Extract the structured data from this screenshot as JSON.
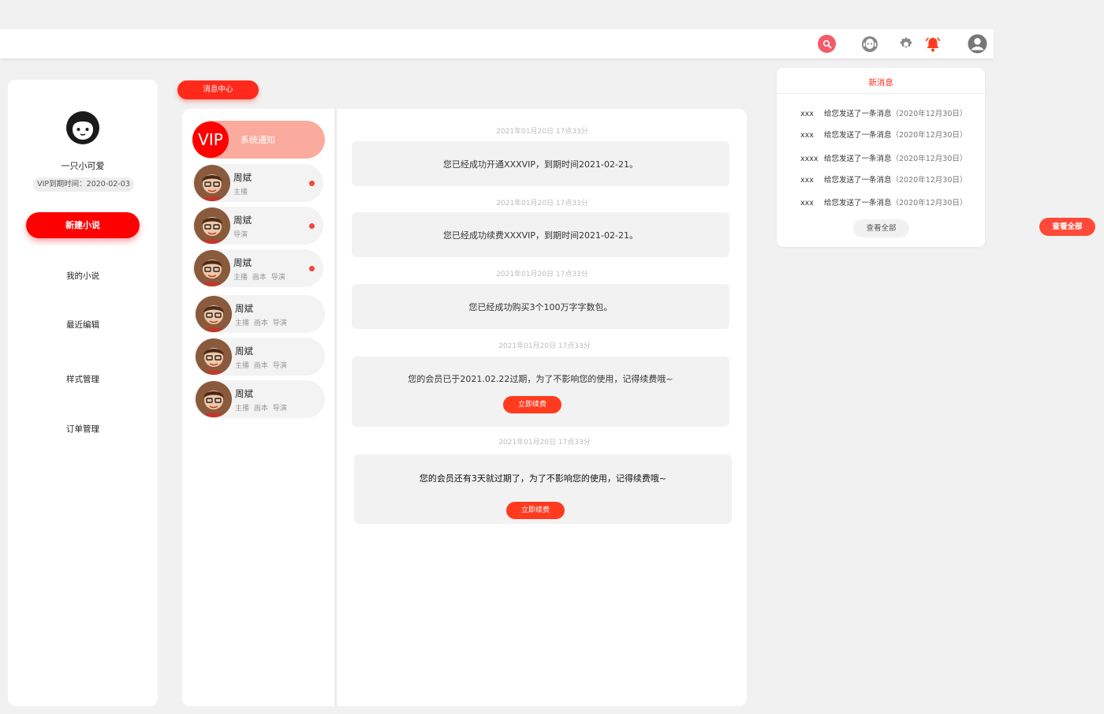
{
  "colors": {
    "accent": "#ff0000",
    "tag_red": "#ff2a1c",
    "soft_red": "#fbaa9e",
    "dot": "#f4453a",
    "bg": "#f1f1f1"
  },
  "topbar": {
    "icons": [
      "search-icon",
      "robot-icon",
      "gear-icon",
      "bell-icon",
      "user-icon"
    ]
  },
  "sidebar": {
    "username": "一只小可爱",
    "vip_expiry": "VIP到期时间：2020-02-03",
    "new_novel": "新建小说",
    "items": [
      {
        "label": "我的小说"
      },
      {
        "label": "最近编辑"
      },
      {
        "label": "样式管理"
      },
      {
        "label": "订单管理"
      }
    ]
  },
  "message_center": {
    "tag": "消息中心"
  },
  "contacts": {
    "system": {
      "badge": "VIP",
      "label": "系统通知"
    },
    "list": [
      {
        "name": "周斌",
        "role": "主播",
        "unread": true
      },
      {
        "name": "周斌",
        "role": "导演",
        "unread": true
      },
      {
        "name": "周斌",
        "role": "主播 画本 导演",
        "unread": true
      },
      {
        "name": "周斌",
        "role": "主播 画本 导演",
        "unread": false
      },
      {
        "name": "周斌",
        "role": "主播 画本 导演",
        "unread": false
      },
      {
        "name": "周斌",
        "role": "主播 画本 导演",
        "unread": false
      }
    ]
  },
  "messages": [
    {
      "time": "2021年01月20日  17点33分",
      "text": "您已经成功开通XXXVIP，到期时间2021-02-21。"
    },
    {
      "time": "2021年01月20日  17点33分",
      "text": "您已经成功续费XXXVIP，到期时间2021-02-21。"
    },
    {
      "time": "2021年01月20日  17点33分",
      "text": "您已经成功购买3个100万字字数包。"
    },
    {
      "time": "2021年01月20日  17点33分",
      "text": "您的会员已于2021.02.22过期，为了不影响您的使用，记得续费哦~",
      "button": "立即续费"
    },
    {
      "time": "2021年01月20日  17点33分",
      "text": "您的会员还有3天就过期了，为了不影响您的使用，记得续费哦~",
      "button": "立即续费"
    }
  ],
  "new_messages": {
    "title": "新消息",
    "items": [
      {
        "sender": "xxx",
        "text": "给您发送了一条消息",
        "date": "（2020年12月30日）"
      },
      {
        "sender": "xxx",
        "text": "给您发送了一条消息",
        "date": "（2020年12月30日）"
      },
      {
        "sender": "xxxx",
        "text": "给您发送了一条消息",
        "date": "（2020年12月30日）"
      },
      {
        "sender": "xxx",
        "text": "给您发送了一条消息",
        "date": "（2020年12月30日）"
      },
      {
        "sender": "xxx",
        "text": "给您发送了一条消息",
        "date": "（2020年12月30日）"
      }
    ],
    "view_all": "查看全部"
  },
  "floating_view_all": "查看全部"
}
